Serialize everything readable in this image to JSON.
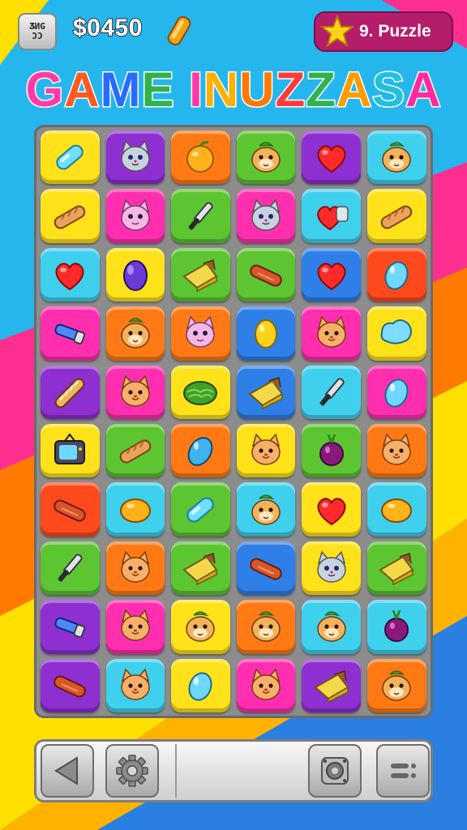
{
  "header": {
    "menu_lines": [
      "ƷИG",
      "ƆƆ"
    ],
    "money": "$0450",
    "level": "9. Puzzle"
  },
  "title": "GAME INUZZASA",
  "title_colors": [
    "#ff3aa8",
    "#ff5a1f",
    "#2a6bff",
    "#2fb34a",
    "#ff3aa8",
    "#ffb000",
    "#ff7a00",
    "#ff3a3a",
    "#2fb34a",
    "#ff9c00",
    "#22c0e0",
    "#ff2aa0",
    "#ff4fa0"
  ],
  "colors": {
    "yellow": "#ffe21a",
    "purple": "#8d2fd1",
    "orange": "#ff7a14",
    "green": "#5cc531",
    "cyan": "#3fd0ee",
    "pink": "#ff2fb0",
    "blue": "#2f7fe8",
    "red": "#ff4a1e"
  },
  "board": [
    [
      {
        "c": "yellow",
        "i": "capsule"
      },
      {
        "c": "purple",
        "i": "cat-gray"
      },
      {
        "c": "orange",
        "i": "orange"
      },
      {
        "c": "green",
        "i": "hamster"
      },
      {
        "c": "purple",
        "i": "heart"
      },
      {
        "c": "cyan",
        "i": "hamster"
      }
    ],
    [
      {
        "c": "yellow",
        "i": "bread"
      },
      {
        "c": "pink",
        "i": "cat-pink"
      },
      {
        "c": "green",
        "i": "knife"
      },
      {
        "c": "pink",
        "i": "cat-gray"
      },
      {
        "c": "cyan",
        "i": "heart-bag"
      },
      {
        "c": "yellow",
        "i": "bread"
      }
    ],
    [
      {
        "c": "cyan",
        "i": "heart"
      },
      {
        "c": "yellow",
        "i": "bean-purple"
      },
      {
        "c": "green",
        "i": "cheese"
      },
      {
        "c": "green",
        "i": "sausage"
      },
      {
        "c": "blue",
        "i": "heart"
      },
      {
        "c": "red",
        "i": "bean-cyan"
      }
    ],
    [
      {
        "c": "pink",
        "i": "flashlight"
      },
      {
        "c": "orange",
        "i": "hamster"
      },
      {
        "c": "orange",
        "i": "cat-pink"
      },
      {
        "c": "blue",
        "i": "bean-yellow"
      },
      {
        "c": "pink",
        "i": "cat-orange"
      },
      {
        "c": "yellow",
        "i": "blob-cyan"
      }
    ],
    [
      {
        "c": "purple",
        "i": "baguette"
      },
      {
        "c": "pink",
        "i": "cat-orange"
      },
      {
        "c": "yellow",
        "i": "lettuce"
      },
      {
        "c": "blue",
        "i": "cheese"
      },
      {
        "c": "cyan",
        "i": "knife"
      },
      {
        "c": "pink",
        "i": "bean-cyan"
      }
    ],
    [
      {
        "c": "yellow",
        "i": "tv"
      },
      {
        "c": "green",
        "i": "bread"
      },
      {
        "c": "orange",
        "i": "bean-blue"
      },
      {
        "c": "yellow",
        "i": "cat-orange"
      },
      {
        "c": "green",
        "i": "beet"
      },
      {
        "c": "orange",
        "i": "cat-orange"
      }
    ],
    [
      {
        "c": "red",
        "i": "sausage"
      },
      {
        "c": "cyan",
        "i": "bean-orange"
      },
      {
        "c": "green",
        "i": "capsule"
      },
      {
        "c": "cyan",
        "i": "hamster"
      },
      {
        "c": "yellow",
        "i": "heart"
      },
      {
        "c": "cyan",
        "i": "bean-orange"
      }
    ],
    [
      {
        "c": "green",
        "i": "knife"
      },
      {
        "c": "orange",
        "i": "cat-orange"
      },
      {
        "c": "green",
        "i": "cheese"
      },
      {
        "c": "blue",
        "i": "sausage"
      },
      {
        "c": "yellow",
        "i": "cat-gray"
      },
      {
        "c": "green",
        "i": "cheese"
      }
    ],
    [
      {
        "c": "purple",
        "i": "flashlight"
      },
      {
        "c": "pink",
        "i": "cat-orange"
      },
      {
        "c": "yellow",
        "i": "hamster"
      },
      {
        "c": "orange",
        "i": "hamster"
      },
      {
        "c": "cyan",
        "i": "hamster"
      },
      {
        "c": "cyan",
        "i": "beet"
      }
    ],
    [
      {
        "c": "purple",
        "i": "sausage"
      },
      {
        "c": "cyan",
        "i": "cat-orange"
      },
      {
        "c": "yellow",
        "i": "bean-cyan"
      },
      {
        "c": "pink",
        "i": "cat-orange"
      },
      {
        "c": "purple",
        "i": "cheese"
      },
      {
        "c": "orange",
        "i": "hamster"
      }
    ]
  ],
  "bottom_bar": {
    "buttons": [
      "back-arrow-icon",
      "gear-icon",
      "camera-icon",
      "menu-icon"
    ]
  }
}
